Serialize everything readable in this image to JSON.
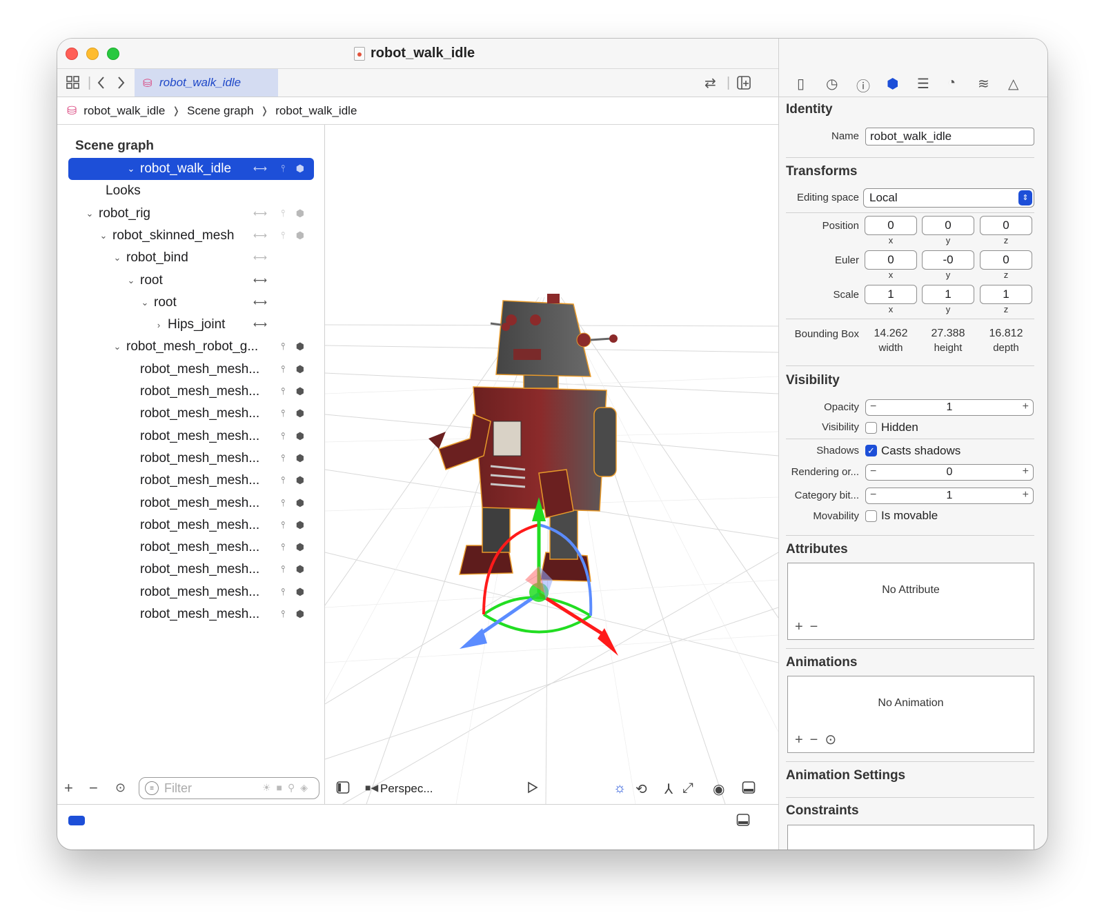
{
  "window": {
    "title": "robot_walk_idle"
  },
  "toolbar": {
    "tab_label": "robot_walk_idle"
  },
  "breadcrumb": [
    "robot_walk_idle",
    "Scene graph",
    "robot_walk_idle"
  ],
  "outline": {
    "title": "Scene graph",
    "rows": [
      {
        "label": "robot_walk_idle",
        "chevron": "⌄",
        "icons": [
          "joint",
          "pin",
          "cube"
        ]
      },
      {
        "label": "Looks",
        "chevron": "",
        "icons": []
      },
      {
        "label": "robot_rig",
        "chevron": "⌄",
        "icons": [
          "joint",
          "pin",
          "cube"
        ]
      },
      {
        "label": "robot_skinned_mesh",
        "chevron": "⌄",
        "icons": [
          "joint",
          "pin",
          "cube"
        ]
      },
      {
        "label": "robot_bind",
        "chevron": "⌄",
        "icons": [
          "joint"
        ]
      },
      {
        "label": "root",
        "chevron": "⌄",
        "icons": [
          "joint"
        ]
      },
      {
        "label": "root",
        "chevron": "⌄",
        "icons": [
          "joint"
        ]
      },
      {
        "label": "Hips_joint",
        "chevron": "›",
        "icons": [
          "joint"
        ]
      },
      {
        "label": "robot_mesh_robot_g...",
        "chevron": "⌄",
        "icons": [
          "pin",
          "cube"
        ]
      },
      {
        "label": "robot_mesh_mesh...",
        "chevron": "",
        "icons": [
          "pin",
          "cube"
        ]
      },
      {
        "label": "robot_mesh_mesh...",
        "chevron": "",
        "icons": [
          "pin",
          "cube"
        ]
      },
      {
        "label": "robot_mesh_mesh...",
        "chevron": "",
        "icons": [
          "pin",
          "cube"
        ]
      },
      {
        "label": "robot_mesh_mesh...",
        "chevron": "",
        "icons": [
          "pin",
          "cube"
        ]
      },
      {
        "label": "robot_mesh_mesh...",
        "chevron": "",
        "icons": [
          "pin",
          "cube"
        ]
      },
      {
        "label": "robot_mesh_mesh...",
        "chevron": "",
        "icons": [
          "pin",
          "cube"
        ]
      },
      {
        "label": "robot_mesh_mesh...",
        "chevron": "",
        "icons": [
          "pin",
          "cube"
        ]
      },
      {
        "label": "robot_mesh_mesh...",
        "chevron": "",
        "icons": [
          "pin",
          "cube"
        ]
      },
      {
        "label": "robot_mesh_mesh...",
        "chevron": "",
        "icons": [
          "pin",
          "cube"
        ]
      },
      {
        "label": "robot_mesh_mesh...",
        "chevron": "",
        "icons": [
          "pin",
          "cube"
        ]
      },
      {
        "label": "robot_mesh_mesh...",
        "chevron": "",
        "icons": [
          "pin",
          "cube"
        ]
      },
      {
        "label": "robot_mesh_mesh...",
        "chevron": "",
        "icons": [
          "pin",
          "cube"
        ]
      }
    ],
    "filter_placeholder": "Filter"
  },
  "viewport": {
    "camera_label": "Perspec..."
  },
  "inspector": {
    "identity": {
      "title": "Identity",
      "name_label": "Name",
      "name_value": "robot_walk_idle"
    },
    "transforms": {
      "title": "Transforms",
      "editing_space_label": "Editing space",
      "editing_space_value": "Local",
      "position_label": "Position",
      "position": [
        "0",
        "0",
        "0"
      ],
      "euler_label": "Euler",
      "euler": [
        "0",
        "-0",
        "0"
      ],
      "scale_label": "Scale",
      "scale": [
        "1",
        "1",
        "1"
      ],
      "axes": [
        "x",
        "y",
        "z"
      ],
      "bounding_box_label": "Bounding Box",
      "bounding_box": [
        {
          "value": "14.262",
          "label": "width"
        },
        {
          "value": "27.388",
          "label": "height"
        },
        {
          "value": "16.812",
          "label": "depth"
        }
      ]
    },
    "visibility": {
      "title": "Visibility",
      "opacity_label": "Opacity",
      "opacity": "1",
      "visibility_label": "Visibility",
      "hidden_label": "Hidden",
      "hidden_checked": false,
      "shadows_label": "Shadows",
      "casts_shadows_label": "Casts shadows",
      "casts_shadows_checked": true,
      "rendering_label": "Rendering or...",
      "rendering": "0",
      "category_label": "Category bit...",
      "category": "1",
      "movability_label": "Movability",
      "movable_label": "Is movable",
      "movable_checked": false
    },
    "attributes": {
      "title": "Attributes",
      "empty": "No Attribute"
    },
    "animations": {
      "title": "Animations",
      "empty": "No Animation"
    },
    "animation_settings": {
      "title": "Animation Settings"
    },
    "constraints": {
      "title": "Constraints"
    }
  },
  "colors": {
    "accent": "#1d4fd8",
    "selection": "#1d4fd8",
    "tab_bg": "#d4dcf2"
  }
}
